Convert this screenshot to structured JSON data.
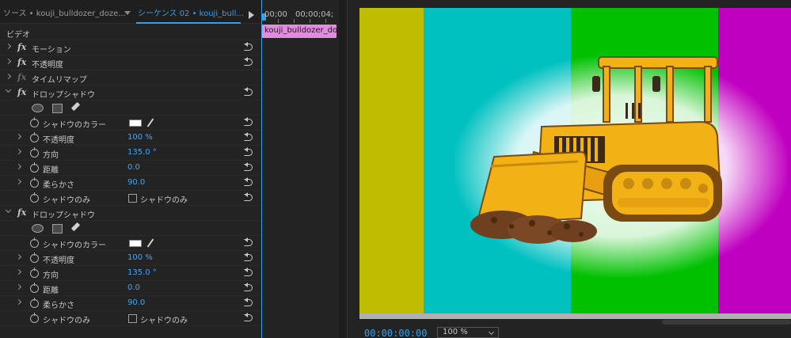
{
  "header": {
    "source_tab": "ソース • kouji_bulldozer_doze...",
    "sequence_tab": "シーケンス 02 • kouji_bull..."
  },
  "timeline": {
    "time_start": "00;00",
    "time_end": "00;00;04;",
    "clip_label": "kouji_bulldozer_doz"
  },
  "effects": {
    "section_video": "ビデオ",
    "motion": "モーション",
    "opacity": "不透明度",
    "time_remap": "タイムリマップ",
    "drop_shadow_1": {
      "name": "ドロップシャドウ",
      "shadow_color_label": "シャドウのカラー",
      "shadow_color": "#ffffff",
      "opacity_label": "不透明度",
      "opacity_value": "100 %",
      "direction_label": "方向",
      "direction_value": "135.0 °",
      "distance_label": "距離",
      "distance_value": "0.0",
      "softness_label": "柔らかさ",
      "softness_value": "90.0",
      "shadow_only_label": "シャドウのみ",
      "shadow_only_check": "シャドウのみ"
    },
    "drop_shadow_2": {
      "name": "ドロップシャドウ",
      "shadow_color_label": "シャドウのカラー",
      "shadow_color": "#ffffff",
      "opacity_label": "不透明度",
      "opacity_value": "100 %",
      "direction_label": "方向",
      "direction_value": "135.0 °",
      "distance_label": "距離",
      "distance_value": "0.0",
      "softness_label": "柔らかさ",
      "softness_value": "90.0",
      "shadow_only_label": "シャドウのみ",
      "shadow_only_check": "シャドウのみ"
    }
  },
  "program": {
    "timecode": "00:00:00:00",
    "zoom": "100 %",
    "color_bars": [
      "#c0bc00",
      "#00c0c0",
      "#00c000",
      "#c000c0"
    ]
  }
}
